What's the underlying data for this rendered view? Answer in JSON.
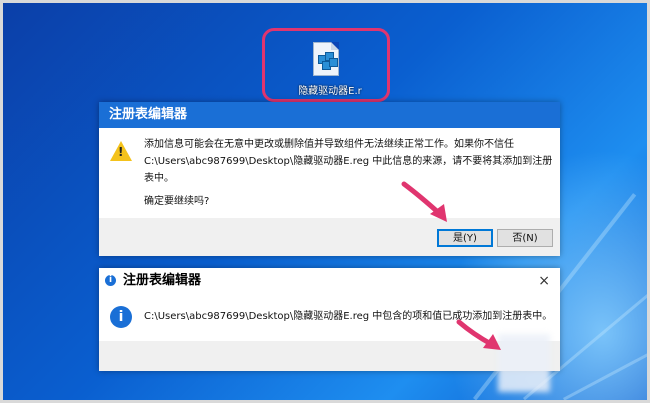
{
  "desktop_file": {
    "label": "隐藏驱动器E.r",
    "icon": "registry-file-icon"
  },
  "dialog1": {
    "title": "注册表编辑器",
    "line1": "添加信息可能会在无意中更改或删除值并导致组件无法继续正常工作。如果你不信任",
    "line2": "C:\\Users\\abc987699\\Desktop\\隐藏驱动器E.reg 中此信息的来源，请不要将其添加到注册",
    "line3": "表中。",
    "question": "确定要继续吗?",
    "yes_label": "是(Y)",
    "no_label": "否(N)",
    "icon": "warning-icon"
  },
  "dialog2": {
    "title": "注册表编辑器",
    "title_icon": "i",
    "close": "×",
    "message": "C:\\Users\\abc987699\\Desktop\\隐藏驱动器E.reg 中包含的项和值已成功添加到注册表中。",
    "icon": "i"
  },
  "colors": {
    "highlight": "#e0356f",
    "title_bar": "#1a6fd6",
    "arrow": "#e0356f"
  }
}
